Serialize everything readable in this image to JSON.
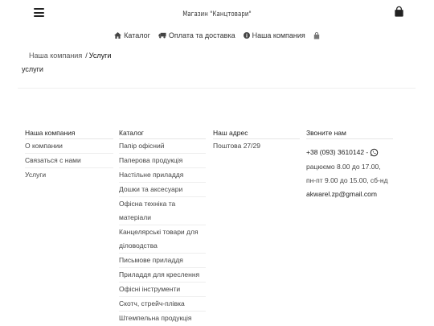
{
  "header": {
    "title": "Магазин \"Канцтовари\"",
    "menu_icon": "hamburger-menu-icon",
    "cart_icon": "shopping-bag-icon"
  },
  "top_nav": {
    "items": [
      {
        "icon": "home-icon",
        "label": "Каталог"
      },
      {
        "icon": "truck-icon",
        "label": "Оплата та доставка"
      },
      {
        "icon": "info-circle-icon",
        "label": "Наша компания"
      },
      {
        "icon": "shopping-bag-icon",
        "label": ""
      }
    ]
  },
  "breadcrumb": {
    "root": "Наша компания",
    "separator": "/",
    "current": "Услуги"
  },
  "page": {
    "title": "услуги"
  },
  "footer": {
    "company": {
      "heading": "Наша компания",
      "items": [
        "О компании",
        "Связаться с нами",
        "Услуги"
      ]
    },
    "catalog": {
      "heading": "Каталог",
      "items": [
        "Папір офісний",
        "Паперова продукція",
        "Настільне приладдя",
        "Дошки та аксесуари",
        "Офісна техніка та матеріали",
        "Канцелярські товари для діловодства",
        "Письмове приладдя",
        "Приладдя для креслення",
        "Офісні інструменти",
        "Скотч, стрейч-плівка",
        "Штемпельна продукція"
      ]
    },
    "address": {
      "heading": "Наш адрес",
      "value": "Поштова 27/29"
    },
    "contacts": {
      "heading": "Звоните нам",
      "phone": "+38 (093) 3610142 -",
      "phone_icon": "whatsapp-icon",
      "hours1": "рацюємо 8.00 до 17.00,",
      "hours2": "пн-пт 9.00 до 15.00, сб-нд",
      "email": "akwarel.zp@gmail.com"
    }
  }
}
